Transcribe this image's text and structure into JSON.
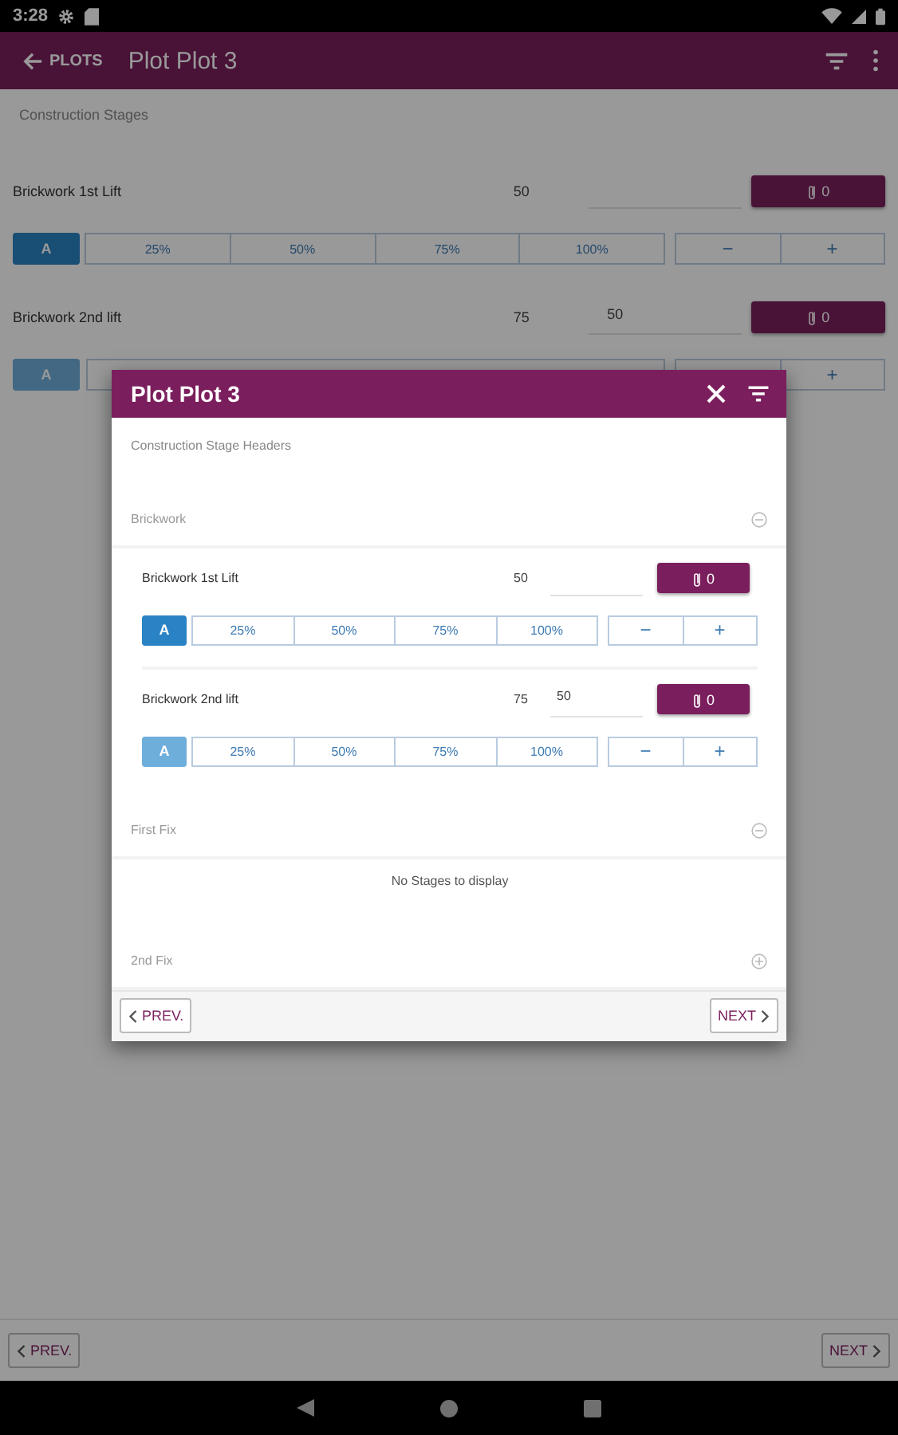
{
  "status_bar": {
    "time": "3:28"
  },
  "app_bar": {
    "back_label": "PLOTS",
    "title": "Plot Plot 3"
  },
  "page": {
    "section_title": "Construction Stages",
    "stages": [
      {
        "name": "Brickwork 1st Lift",
        "target": "50",
        "attachments": "0",
        "a_label": "A",
        "a_active": true,
        "percents": [
          "25%",
          "50%",
          "75%",
          "100%"
        ],
        "minus": "−",
        "plus": "+"
      },
      {
        "name": "Brickwork 2nd lift",
        "target": "75",
        "field_value": "50",
        "attachments": "0",
        "a_label": "A",
        "a_active": false,
        "plus": "+"
      }
    ],
    "footer": {
      "prev": "PREV.",
      "next": "NEXT"
    }
  },
  "dialog": {
    "title": "Plot Plot 3",
    "subtitle": "Construction Stage Headers",
    "groups": [
      {
        "name": "Brickwork",
        "expanded": true,
        "stages": [
          {
            "name": "Brickwork 1st Lift",
            "target": "50",
            "attachments": "0",
            "a_label": "A",
            "a_active": true,
            "percents": [
              "25%",
              "50%",
              "75%",
              "100%"
            ],
            "minus": "−",
            "plus": "+"
          },
          {
            "name": "Brickwork 2nd lift",
            "target": "75",
            "field_value": "50",
            "attachments": "0",
            "a_label": "A",
            "a_active": false,
            "percents": [
              "25%",
              "50%",
              "75%",
              "100%"
            ],
            "minus": "−",
            "plus": "+"
          }
        ]
      },
      {
        "name": "First Fix",
        "expanded": true,
        "empty_message": "No Stages to display"
      },
      {
        "name": "2nd Fix",
        "expanded": false
      }
    ],
    "footer": {
      "prev": "PREV.",
      "next": "NEXT"
    }
  }
}
